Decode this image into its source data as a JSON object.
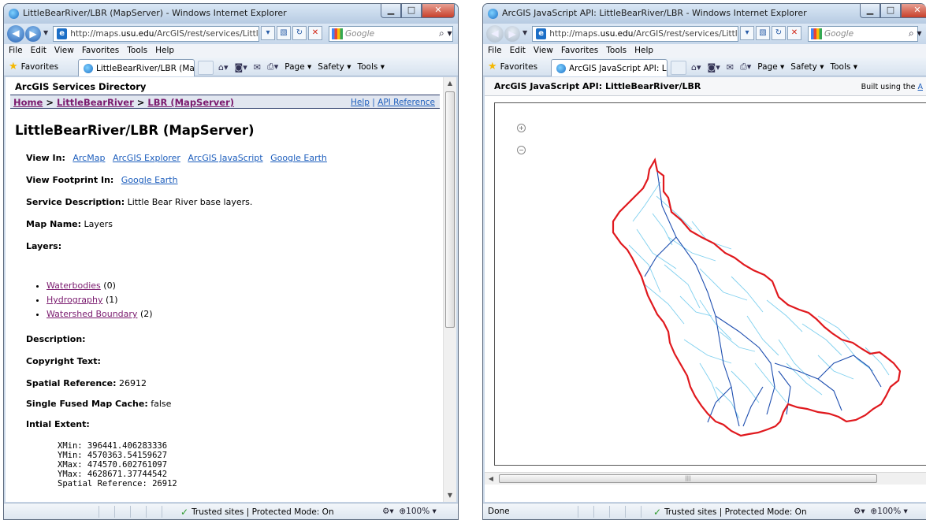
{
  "left_window": {
    "title": "LittleBearRiver/LBR (MapServer) - Windows Internet Explorer",
    "url_prefix": "http://maps.",
    "url_domain": "usu.edu",
    "url_suffix": "/ArcGIS/rest/services/LittleB",
    "search_placeholder": "Google",
    "menu": [
      "File",
      "Edit",
      "View",
      "Favorites",
      "Tools",
      "Help"
    ],
    "favorites_label": "Favorites",
    "tab_label": "LittleBearRiver/LBR (Ma...",
    "cmd_page": "Page",
    "cmd_safety": "Safety",
    "cmd_tools": "Tools",
    "status_zone": "Trusted sites | Protected Mode: On",
    "status_zoom": "100%",
    "page": {
      "directory_title": "ArcGIS Services Directory",
      "crumb_home": "Home",
      "crumb_folder": "LittleBearRiver",
      "crumb_service": "LBR (MapServer)",
      "help_link": "Help",
      "api_ref_link": "API Reference",
      "service_title": "LittleBearRiver/LBR (MapServer)",
      "view_in_label": "View In:",
      "view_in_links": [
        "ArcMap",
        "ArcGIS Explorer",
        "ArcGIS JavaScript",
        "Google Earth"
      ],
      "footprint_label": "View Footprint In:",
      "footprint_link": "Google Earth",
      "service_desc_label": "Service Description:",
      "service_desc_value": "Little Bear River base layers.",
      "map_name_label": "Map Name:",
      "map_name_value": "Layers",
      "layers_label": "Layers:",
      "layers": [
        {
          "name": "Waterbodies",
          "id": "(0)"
        },
        {
          "name": "Hydrography",
          "id": "(1)"
        },
        {
          "name": "Watershed Boundary",
          "id": "(2)"
        }
      ],
      "description_label": "Description:",
      "copyright_label": "Copyright Text:",
      "spatial_ref_label": "Spatial Reference:",
      "spatial_ref_value": "26912",
      "cache_label": "Single Fused Map Cache:",
      "cache_value": "false",
      "extent_label": "Intial Extent:",
      "extent_lines": [
        "XMin: 396441.406283336",
        "YMin: 4570363.54159627",
        "XMax: 474570.602761097",
        "YMax: 4628671.37744542",
        "Spatial Reference: 26912"
      ]
    }
  },
  "right_window": {
    "title": "ArcGIS JavaScript API: LittleBearRiver/LBR - Windows Internet Explorer",
    "url_prefix": "http://maps.",
    "url_domain": "usu.edu",
    "url_suffix": "/ArcGIS/rest/services/LittleB",
    "search_placeholder": "Google",
    "menu": [
      "File",
      "Edit",
      "View",
      "Favorites",
      "Tools",
      "Help"
    ],
    "favorites_label": "Favorites",
    "tab_label": "ArcGIS JavaScript API: Li...",
    "cmd_page": "Page",
    "cmd_safety": "Safety",
    "cmd_tools": "Tools",
    "status_done": "Done",
    "status_zone": "Trusted sites | Protected Mode: On",
    "status_zoom": "100%",
    "page": {
      "header_title": "ArcGIS JavaScript API: LittleBearRiver/LBR",
      "built_prefix": "Built using the",
      "built_link": "A",
      "zoom_in": "+",
      "zoom_out": "−"
    }
  },
  "colors": {
    "boundary": "#e0191e",
    "river_main": "#1f4fb0",
    "river_minor": "#7fd0ef",
    "visited_link": "#7a1a6e",
    "link": "#1d5ebd"
  }
}
